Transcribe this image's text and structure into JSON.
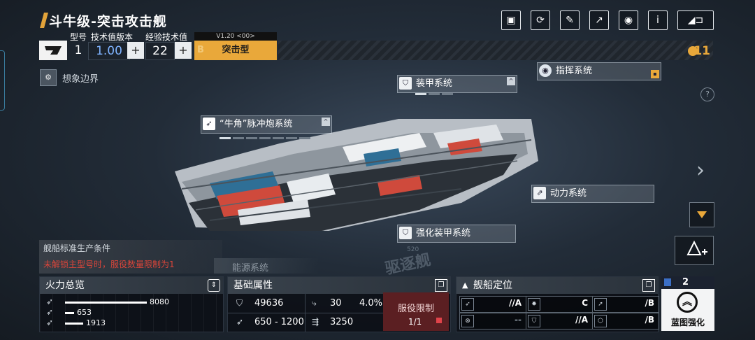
{
  "header": {
    "title": "斗牛级-突击攻击舰"
  },
  "info": {
    "model_label": "型号",
    "tech_version_label": "技术值版本",
    "exp_tech_label": "经验技术值",
    "model_value": "1",
    "tech_version_value": "1.00",
    "exp_tech_value": "22",
    "plus_glyph": "+",
    "version": "V1.20 <00>",
    "type_letter": "B",
    "type_label": "突击型",
    "rank_value": "11"
  },
  "top_icons": [
    "gallery-icon",
    "refresh-icon",
    "paint-icon",
    "export-icon",
    "view-icon",
    "info-icon",
    "back-icon"
  ],
  "info_glyph": "i",
  "imagine_label": "想象边界",
  "systems": {
    "armor": "装甲系统",
    "command": "指挥系统",
    "pulse_cannon": "“牛角”脉冲炮系统",
    "power": "动力系统",
    "enhanced_armor": "强化装甲系统",
    "energy": "能源系统"
  },
  "production": {
    "heading": "舰船标准生产条件",
    "warning": "未解锁主型号时，服役数量限制为1"
  },
  "firepower": {
    "title": "火力总览",
    "rows": [
      {
        "value": "8080",
        "fraction": 0.9
      },
      {
        "value": "653",
        "fraction": 0.1
      },
      {
        "value": "1913",
        "fraction": 0.2
      }
    ]
  },
  "attributes": {
    "title": "基础属性",
    "hp": "49636",
    "armor": "30",
    "armor_pct": "4.0%",
    "damage_range": "650 - 1200",
    "speed": "3250"
  },
  "service": {
    "title": "服役限制",
    "value": "1/1"
  },
  "positioning": {
    "title": "舰船定位",
    "cells": [
      {
        "grade": "//A"
      },
      {
        "grade": "C"
      },
      {
        "grade": "/B"
      },
      {
        "grade": "--"
      },
      {
        "grade": "//A"
      },
      {
        "grade": "/B"
      }
    ]
  },
  "blueprint": {
    "level": "2",
    "label": "蓝图强化"
  },
  "watermark": {
    "class_label": "驱逐舰",
    "number": "520"
  },
  "help_glyph": "?",
  "next_glyph": "›",
  "colors": {
    "accent": "#e9a83a",
    "warning": "#d9453a",
    "service_bg": "#5b1f22"
  }
}
